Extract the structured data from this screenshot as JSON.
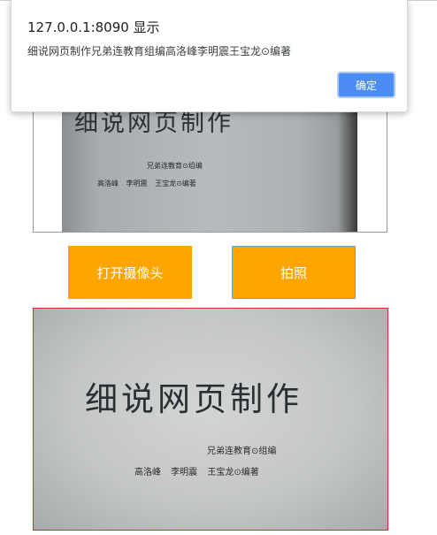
{
  "alert": {
    "origin": "127.0.0.1:8090 显示",
    "message": "细说网页制作兄弟连教育组编高洛峰李明震王宝龙⊙编著",
    "ok_label": "确定"
  },
  "video": {
    "book_title": "细说网页制作",
    "line1": "兄弟连教育⊙组编",
    "line2": "高洛峰 李明震 王宝龙⊙编著"
  },
  "buttons": {
    "open_camera": "打开摄像头",
    "take_photo": "拍照"
  },
  "photo": {
    "book_title": "细说网页制作",
    "line1": "兄弟连教育⊙组编",
    "line2": "高洛峰 李明震 王宝龙⊙编著"
  },
  "colors": {
    "button_bg": "#ffa500",
    "canvas_border": "#d62b2b",
    "dialog_ok": "#4c8cf5"
  }
}
